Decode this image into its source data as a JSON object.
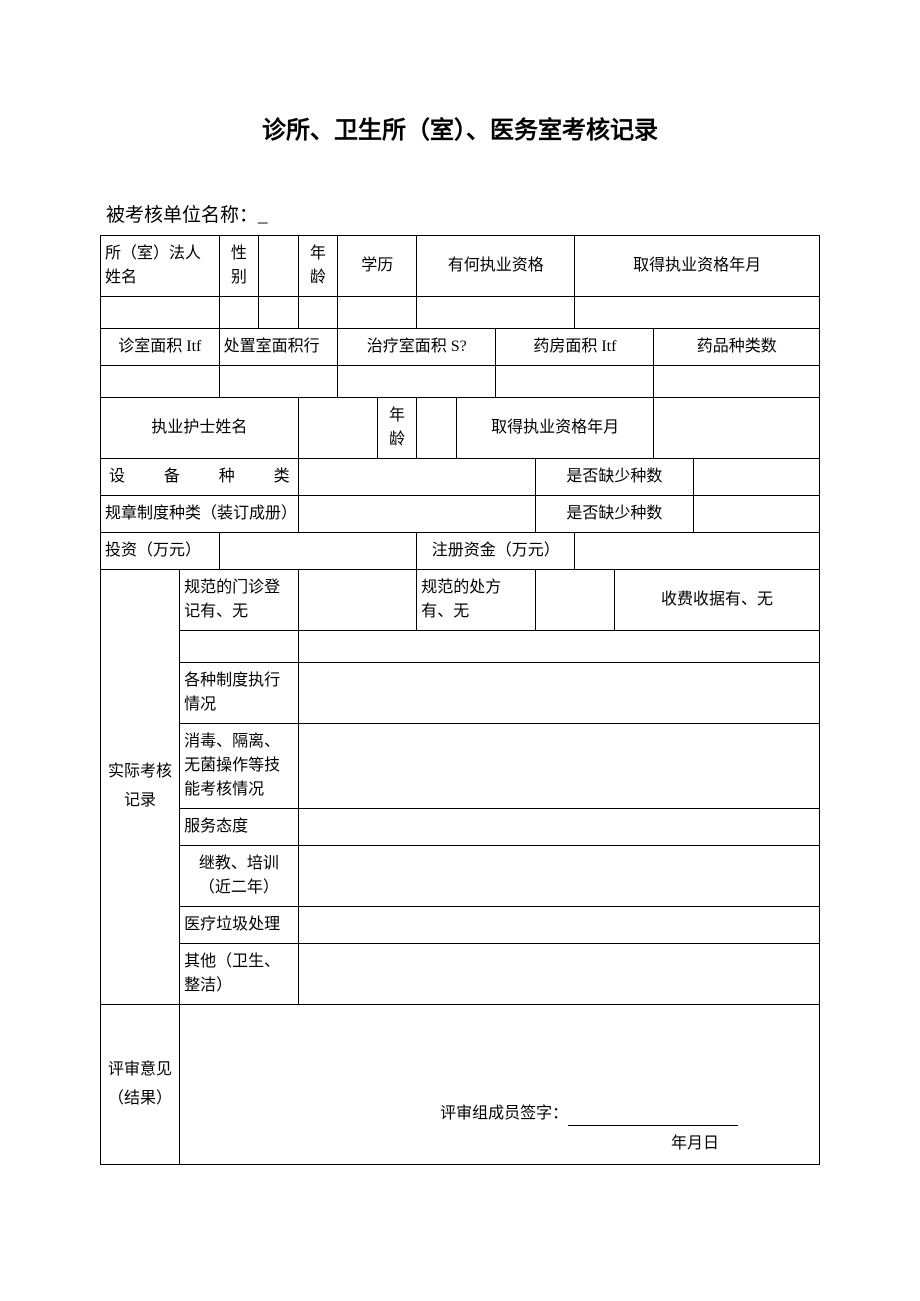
{
  "title": "诊所、卫生所（室）、医务室考核记录",
  "subtitle": "被考核单位名称：_",
  "r1": {
    "legal_name": "所（室）法人姓名",
    "gender": "性别",
    "age": "年龄",
    "edu": "学历",
    "qual": "有何执业资格",
    "qual_date": "取得执业资格年月"
  },
  "r2": {
    "c1": "诊室面积 Itf",
    "c2": "处置室面积行",
    "c3": "治疗室面积 S?",
    "c4": "药房面积 Itf",
    "c5": "药品种类数"
  },
  "r3": {
    "nurse": "执业护士姓名",
    "age": "年龄",
    "date": "取得执业资格年月"
  },
  "r4": {
    "l1": "设备种",
    "l2": "类",
    "short": "是否缺少种数"
  },
  "r5": {
    "label": "规章制度种类（装订成册）",
    "short": "是否缺少种数"
  },
  "r6": {
    "l": "投资（万元）",
    "r": "注册资金（万元）"
  },
  "r7": {
    "a": "规范的门诊登记有、无",
    "b": "规范的处方有、无",
    "c": "收费收据有、无"
  },
  "side": "实际考核记录",
  "rows": {
    "a": "各种制度执行情况",
    "b": "消毒、隔离、无菌操作等技能考核情况",
    "c": "服务态度",
    "d": "继教、培训（近二年）",
    "e": "医疗垃圾处理",
    "f": "其他（卫生、整洁）"
  },
  "review": "评审意见（结果）",
  "sig": "评审组成员签字：",
  "date": "年月日"
}
